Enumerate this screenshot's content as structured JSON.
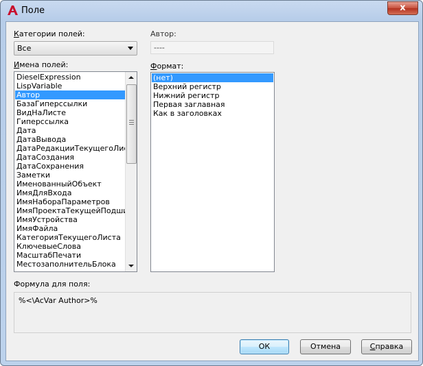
{
  "window": {
    "title": "Поле",
    "close_glyph": "x"
  },
  "colors": {
    "selection": "#3399ff",
    "close_button": "#c7513d",
    "app_icon": "#c8102e"
  },
  "field_categories": {
    "label_u": "К",
    "label_rest": "атегории полей:",
    "selected": "Все"
  },
  "author": {
    "label": "Автор:",
    "value": "----"
  },
  "field_names": {
    "label_u": "И",
    "label_rest": "мена полей:",
    "items": [
      "DieselExpression",
      "LispVariable",
      "Автор",
      "БазаГиперссылки",
      "ВидНаЛисте",
      "Гиперссылка",
      "Дата",
      "ДатаВывода",
      "ДатаРедакцииТекущегоЛиста",
      "ДатаСоздания",
      "ДатаСохранения",
      "Заметки",
      "ИменованныйОбъект",
      "ИмяДляВхода",
      "ИмяНабораПараметров",
      "ИмяПроектаТекущейПодшивки",
      "ИмяУстройства",
      "ИмяФайла",
      "КатегорияТекущегоЛиста",
      "КлючевыеСлова",
      "МасштабПечати",
      "МестозаполнительБлока"
    ],
    "selected_index": 2
  },
  "format": {
    "label_u": "Ф",
    "label_rest": "ормат:",
    "items": [
      "(нет)",
      "Верхний регистр",
      "Нижний регистр",
      "Первая заглавная",
      "Как в заголовках"
    ],
    "selected_index": 0
  },
  "formula": {
    "label": "Формула для поля:",
    "value": "%<\\AcVar Author>%"
  },
  "buttons": {
    "ok": "ОК",
    "cancel": "Отмена",
    "help_u": "С",
    "help_rest": "правка"
  },
  "icons": {
    "app": "autocad-a-icon",
    "combo_arrow": "chevron-down-icon",
    "scroll_up": "scroll-up-arrow-icon",
    "scroll_down": "scroll-down-arrow-icon"
  }
}
